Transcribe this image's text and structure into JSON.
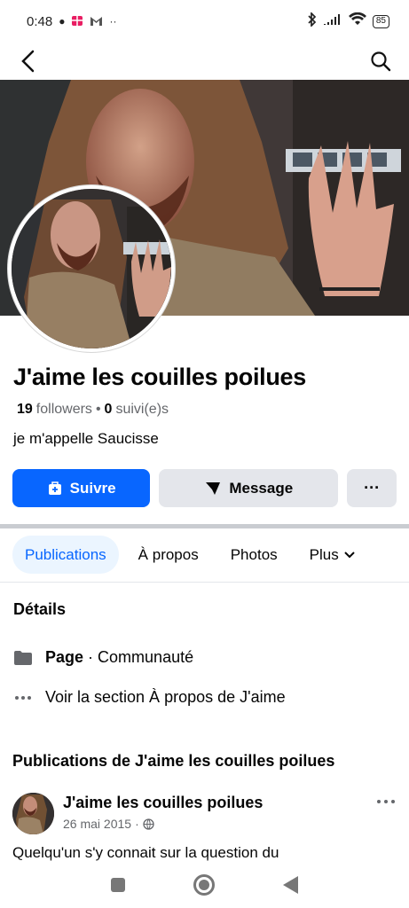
{
  "status_bar": {
    "time": "0:48",
    "icons_left": [
      "message-icon",
      "gift-icon",
      "gmail-icon",
      "more-dots-icon"
    ],
    "icons_right": [
      "bluetooth-icon",
      "signal-icon",
      "wifi-icon",
      "battery-icon"
    ],
    "battery": "85"
  },
  "navigation": {
    "back_icon": "chevron-left-icon",
    "search_icon": "search-icon"
  },
  "profile": {
    "name": "J'aime les couilles poilues",
    "followers_count": "19",
    "followers_label": "followers",
    "separator": "•",
    "following_count": "0",
    "following_label": "suivi(e)s",
    "bio": "je m'appelle Saucisse"
  },
  "actions": {
    "follow": "Suivre",
    "message": "Message",
    "more": "···"
  },
  "tabs": [
    {
      "label": "Publications"
    },
    {
      "label": "À propos"
    },
    {
      "label": "Photos"
    },
    {
      "label": "Plus"
    }
  ],
  "details": {
    "title": "Détails",
    "page_label": "Page",
    "page_type": "Communauté",
    "about_link": "Voir la section À propos de J'aime"
  },
  "posts": {
    "section_title": "Publications de J'aime les couilles poilues",
    "items": [
      {
        "author": "J'aime les couilles poilues",
        "date": "26 mai 2015",
        "text": "Quelqu'un s'y connait sur la question du"
      }
    ]
  },
  "system_nav": {
    "recent_icon": "square-recent-icon",
    "home_icon": "home-circle-icon",
    "back_icon": "triangle-back-icon"
  },
  "colors": {
    "brand": "#0866FF",
    "secondary_button": "#E4E6EB",
    "divider": "#C9CCD1"
  }
}
